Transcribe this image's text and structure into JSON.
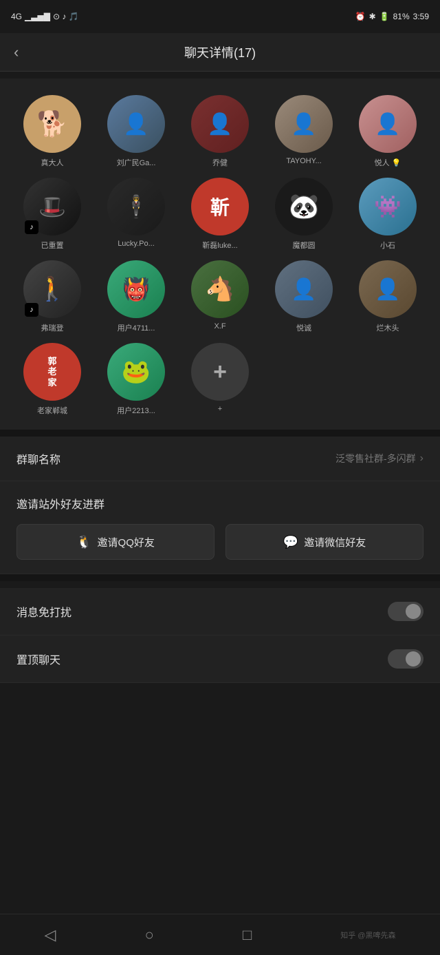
{
  "statusBar": {
    "signal": "4G",
    "wifi": "📶",
    "time": "3:59",
    "battery": "81%"
  },
  "header": {
    "backLabel": "‹",
    "title": "聊天详情(17)"
  },
  "members": [
    {
      "name": "真大人",
      "avatarClass": "av-dog",
      "content": "🐕",
      "hasTiktok": false
    },
    {
      "name": "刘广民Ga...",
      "avatarClass": "av-person1",
      "content": "👤",
      "hasTiktok": false
    },
    {
      "name": "乔健",
      "avatarClass": "av-person2",
      "content": "👤",
      "hasTiktok": false
    },
    {
      "name": "TAYOHY...",
      "avatarClass": "av-person3",
      "content": "👤",
      "hasTiktok": false
    },
    {
      "name": "悦人 💡",
      "avatarClass": "av-person4",
      "content": "👤",
      "hasTiktok": false
    },
    {
      "name": "已重置",
      "avatarClass": "av-hat",
      "content": "🎩",
      "hasTiktok": true
    },
    {
      "name": "Lucky.Po...",
      "avatarClass": "av-lucky",
      "content": "👤",
      "hasTiktok": false
    },
    {
      "name": "靳磊luke...",
      "avatarClass": "av-zhan",
      "content": "靳",
      "hasTiktok": false
    },
    {
      "name": "魔都圆",
      "avatarClass": "av-bear",
      "content": "🐻",
      "hasTiktok": false
    },
    {
      "name": "小石",
      "avatarClass": "av-xiao",
      "content": "👾",
      "hasTiktok": false
    },
    {
      "name": "弗瑞登",
      "avatarClass": "av-frei",
      "content": "🚶",
      "hasTiktok": true
    },
    {
      "name": "用户4711...",
      "avatarClass": "av-user47",
      "content": "👹",
      "hasTiktok": false
    },
    {
      "name": "X.F",
      "avatarClass": "av-xf",
      "content": "🐴",
      "hasTiktok": false
    },
    {
      "name": "悦诚",
      "avatarClass": "av-yue",
      "content": "👤",
      "hasTiktok": false
    },
    {
      "name": "烂木头",
      "avatarClass": "av-zha",
      "content": "👤",
      "hasTiktok": false
    },
    {
      "name": "老家郸城",
      "avatarClass": "av-laojia",
      "content": "郭\n老\n家",
      "hasTiktok": false
    },
    {
      "name": "用户2213...",
      "avatarClass": "av-user22",
      "content": "🐸",
      "hasTiktok": false
    },
    {
      "name": "+",
      "avatarClass": "av-add",
      "content": "+",
      "hasTiktok": false,
      "isAdd": true
    }
  ],
  "settings": {
    "groupNameLabel": "群聊名称",
    "groupNameValue": "泛零售社群-多闪群",
    "inviteTitle": "邀请站外好友进群",
    "inviteQQ": "邀请QQ好友",
    "inviteWechat": "邀请微信好友",
    "dndLabel": "消息免打扰",
    "topChatLabel": "置顶聊天"
  },
  "bottomNav": {
    "back": "◁",
    "home": "○",
    "recent": "□",
    "credit": "知乎 @黑啤先森"
  }
}
